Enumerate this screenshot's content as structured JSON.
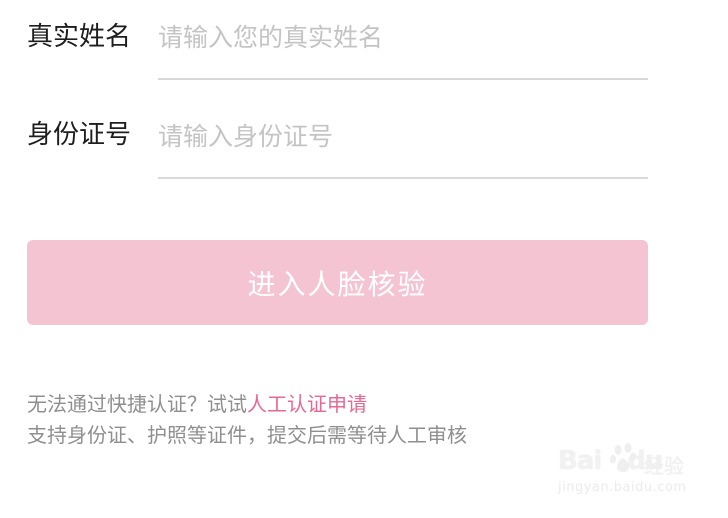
{
  "form": {
    "fields": [
      {
        "label": "真实姓名",
        "placeholder": "请输入您的真实姓名",
        "value": ""
      },
      {
        "label": "身份证号",
        "placeholder": "请输入身份证号",
        "value": ""
      }
    ],
    "submit_label": "进入人脸核验"
  },
  "help": {
    "line1_text": "无法通过快捷认证？试试",
    "line1_link": "人工认证申请",
    "line2_text": "支持身份证、护照等证件，提交后需等待人工审核"
  },
  "watermark": {
    "logo_text": "Bai",
    "logo_suffix": "du",
    "name": "经验",
    "url": "jingyan.baidu.com"
  },
  "colors": {
    "button_bg": "#f4c4d3",
    "link": "#e56a93",
    "label_text": "#1e1e1e",
    "placeholder": "#c4c4c4",
    "help_text": "#8f8f8f",
    "divider": "#d9d9d9"
  }
}
